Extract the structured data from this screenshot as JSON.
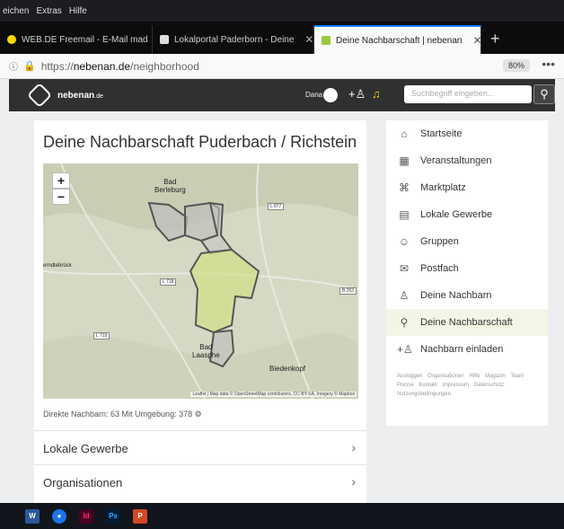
{
  "menubar": {
    "items": [
      "eichen",
      "Extras",
      "Hilfe"
    ]
  },
  "tabs": [
    {
      "label": "WEB.DE Freemail - E-Mail mad",
      "close": "✕"
    },
    {
      "label": "Lokalportal Paderborn - Deine",
      "close": "✕"
    },
    {
      "label": "Deine Nachbarschaft | nebenan",
      "close": "✕"
    }
  ],
  "newtab": "+",
  "address": {
    "scheme": "https://",
    "domain": "nebenan.de",
    "path": "/neighborhood",
    "zoom": "80%",
    "menu": "•••"
  },
  "site": {
    "logo_text": "nebenan",
    "logo_tld": ".de",
    "user": "Dana",
    "search_placeholder": "Suchbegriff eingeben...",
    "search_icon": "search-icon"
  },
  "main": {
    "title": "Deine Nachbarschaft Puderbach / Richstein",
    "map": {
      "zoom_in": "+",
      "zoom_out": "−",
      "towns": {
        "bb1": "Bad",
        "bb2": "Berleburg",
        "bl1": "Bad",
        "bl2": "Laasphe",
        "bied": "Biedenkopf",
        "erndte": "erndtebrück"
      },
      "roads": {
        "r1": "L 877",
        "r2": "L 718",
        "r3": "B 253",
        "r4": "L 719"
      },
      "attribution": "Leaflet | Map data © OpenStreetMap contributors, CC-BY-SA, Imagery © Mapbox"
    },
    "stats": "Direkte Nachbarn: 63   Mit Umgebung: 378",
    "rows": [
      {
        "label": "Lokale Gewerbe",
        "chevron": "›"
      },
      {
        "label": "Organisationen",
        "chevron": "›"
      }
    ]
  },
  "sidebar": {
    "items": [
      {
        "label": "Startseite",
        "icon": "home-icon",
        "glyph": "⌂"
      },
      {
        "label": "Veranstaltungen",
        "icon": "calendar-icon",
        "glyph": "▦"
      },
      {
        "label": "Marktplatz",
        "icon": "gift-icon",
        "glyph": "⌘"
      },
      {
        "label": "Lokale Gewerbe",
        "icon": "shop-icon",
        "glyph": "▤"
      },
      {
        "label": "Gruppen",
        "icon": "group-icon",
        "glyph": "☺"
      },
      {
        "label": "Postfach",
        "icon": "mail-icon",
        "glyph": "✉"
      },
      {
        "label": "Deine Nachbarn",
        "icon": "users-icon",
        "glyph": "♙"
      },
      {
        "label": "Deine Nachbarschaft",
        "icon": "neighborhood-icon",
        "glyph": "⚲"
      },
      {
        "label": "Nachbarn einladen",
        "icon": "invite-icon",
        "glyph": "+♙"
      }
    ],
    "links": [
      "Ausloggen",
      "Organisationen",
      "Hilfe",
      "Magazin",
      "Team",
      "Presse",
      "Kontakt",
      "Impressum",
      "Datenschutz",
      "Nutzungsbedingungen"
    ]
  },
  "taskbar": {
    "apps": [
      {
        "name": "word-icon",
        "label": "W",
        "color": "#2b579a"
      },
      {
        "name": "thunderbird-icon",
        "label": "●",
        "color": "#1a73e8"
      },
      {
        "name": "indesign-icon",
        "label": "Id",
        "color": "#49021f"
      },
      {
        "name": "photoshop-icon",
        "label": "Ps",
        "color": "#001e36"
      },
      {
        "name": "powerpoint-icon",
        "label": "P",
        "color": "#d24726"
      }
    ]
  }
}
